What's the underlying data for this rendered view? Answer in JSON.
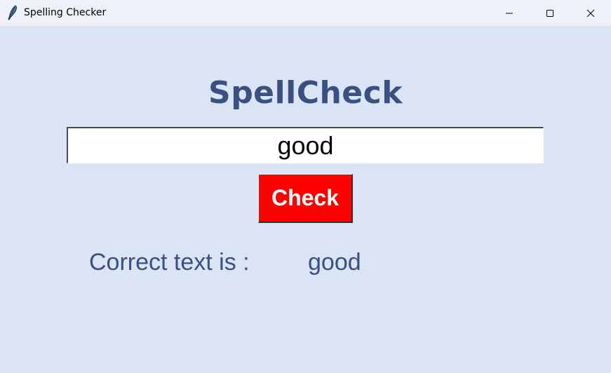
{
  "window": {
    "title": "Spelling Checker",
    "controls": [
      "minimize-icon",
      "maximize-icon",
      "close-icon"
    ]
  },
  "app": {
    "heading": "SpellCheck",
    "input_value": "good",
    "check_button_label": "Check",
    "result_label": "Correct text is :",
    "result_value": "good"
  },
  "colors": {
    "background": "#dae4f4",
    "titlebar": "#eef2f8",
    "heading_text": "#3a5080",
    "button_bg": "#ff0000",
    "button_text": "#ffffff"
  }
}
